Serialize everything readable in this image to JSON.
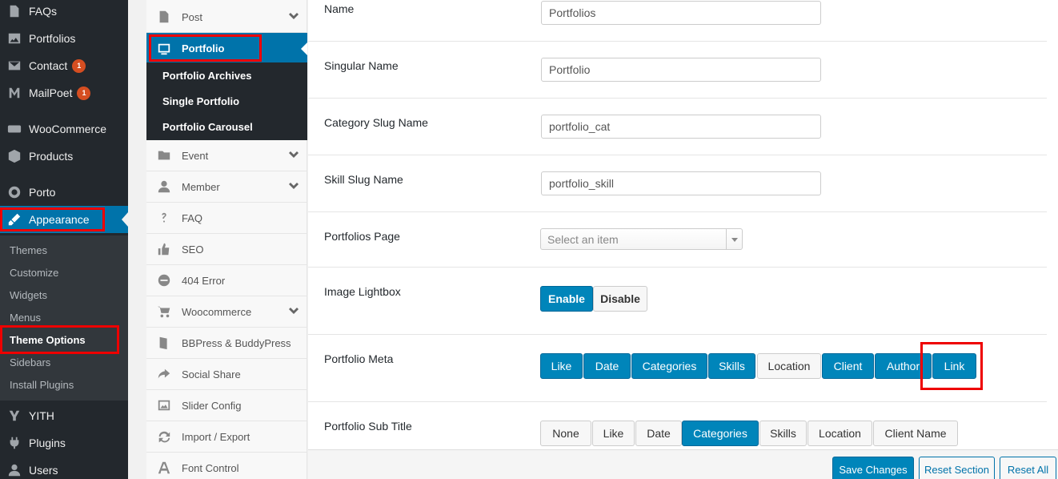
{
  "sidebar": {
    "items": [
      {
        "label": "FAQs",
        "icon": "page-icon"
      },
      {
        "label": "Portfolios",
        "icon": "image-icon"
      },
      {
        "label": "Contact",
        "icon": "mail-icon",
        "badge": "1"
      },
      {
        "label": "MailPoet",
        "icon": "mailpoet-icon",
        "badge": "1"
      },
      {
        "label": "WooCommerce",
        "icon": "woo-icon"
      },
      {
        "label": "Products",
        "icon": "box-icon"
      },
      {
        "label": "Porto",
        "icon": "circle-icon"
      },
      {
        "label": "Appearance",
        "icon": "brush-icon"
      },
      {
        "label": "YITH",
        "icon": "yith-icon"
      },
      {
        "label": "Plugins",
        "icon": "plug-icon"
      },
      {
        "label": "Users",
        "icon": "user-icon"
      }
    ],
    "submenu": [
      "Themes",
      "Customize",
      "Widgets",
      "Menus",
      "Theme Options",
      "Sidebars",
      "Install Plugins"
    ]
  },
  "options_nav": {
    "items": [
      {
        "label": "Post",
        "icon": "post-icon"
      },
      {
        "label": "Portfolio",
        "icon": "monitor-icon"
      },
      {
        "label": "Event",
        "icon": "folder-icon"
      },
      {
        "label": "Member",
        "icon": "person-icon"
      },
      {
        "label": "FAQ",
        "icon": "question-icon"
      },
      {
        "label": "SEO",
        "icon": "thumbs-up-icon"
      },
      {
        "label": "404 Error",
        "icon": "minus-circle-icon"
      },
      {
        "label": "Woocommerce",
        "icon": "cart-icon"
      },
      {
        "label": "BBPress & BuddyPress",
        "icon": "book-icon"
      },
      {
        "label": "Social Share",
        "icon": "share-icon"
      },
      {
        "label": "Slider Config",
        "icon": "picture-icon"
      },
      {
        "label": "Import / Export",
        "icon": "refresh-icon"
      },
      {
        "label": "Font Control",
        "icon": "font-icon"
      }
    ],
    "portfolio_sub": [
      "Portfolio Archives",
      "Single Portfolio",
      "Portfolio Carousel"
    ]
  },
  "fields": {
    "name": {
      "label": "Name",
      "value": "Portfolios"
    },
    "singular": {
      "label": "Singular Name",
      "value": "Portfolio"
    },
    "category_slug": {
      "label": "Category Slug Name",
      "value": "portfolio_cat"
    },
    "skill_slug": {
      "label": "Skill Slug Name",
      "value": "portfolio_skill"
    },
    "portfolios_page": {
      "label": "Portfolios Page",
      "placeholder": "Select an item"
    },
    "lightbox": {
      "label": "Image Lightbox",
      "options": [
        "Enable",
        "Disable"
      ]
    },
    "meta": {
      "label": "Portfolio Meta",
      "options": [
        "Like",
        "Date",
        "Categories",
        "Skills",
        "Location",
        "Client",
        "Author",
        "Link"
      ]
    },
    "subtitle": {
      "label": "Portfolio Sub Title",
      "options": [
        "None",
        "Like",
        "Date",
        "Categories",
        "Skills",
        "Location",
        "Client Name"
      ]
    }
  },
  "footer": {
    "save": "Save Changes",
    "reset_section": "Reset Section",
    "reset_all": "Reset All"
  },
  "colors": {
    "accent": "#0085ba",
    "sidebar": "#23282d",
    "highlight": "#e00000"
  }
}
